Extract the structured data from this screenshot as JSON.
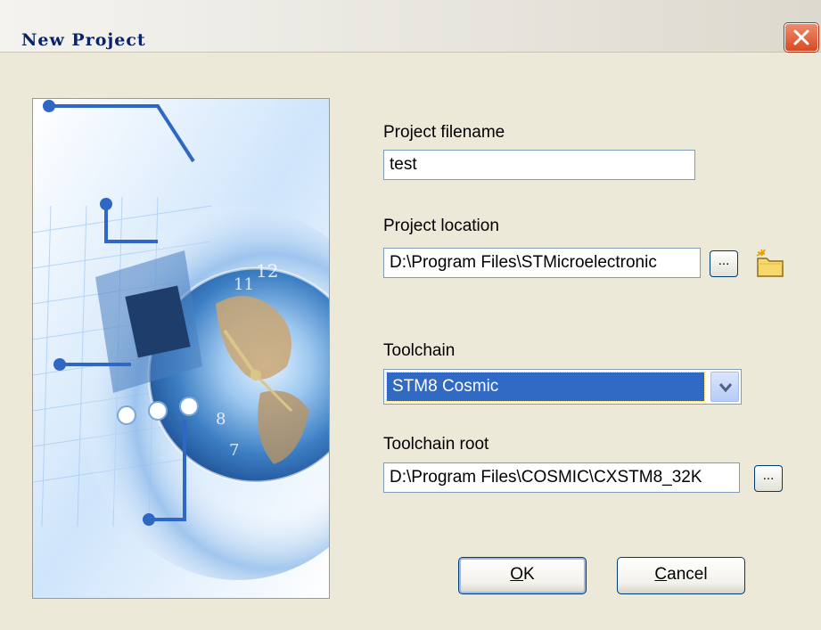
{
  "window": {
    "title": "New Project"
  },
  "fields": {
    "project_filename": {
      "label": "Project filename",
      "value": "test"
    },
    "project_location": {
      "label": "Project location",
      "value": "D:\\Program Files\\STMicroelectronic",
      "browse_label": "..."
    },
    "toolchain": {
      "label": "Toolchain",
      "selected": "STM8 Cosmic"
    },
    "toolchain_root": {
      "label": "Toolchain root",
      "value": "D:\\Program Files\\COSMIC\\CXSTM8_32K",
      "browse_label": "..."
    }
  },
  "buttons": {
    "ok": {
      "mnemonic": "O",
      "rest": "K"
    },
    "cancel": {
      "mnemonic": "C",
      "rest": "ancel"
    }
  },
  "icons": {
    "close": "close-icon",
    "new_folder": "new-folder-icon",
    "dropdown": "chevron-down-icon"
  },
  "colors": {
    "title_text": "#0a246a",
    "selection": "#316ac5",
    "dialog_bg": "#ECE9D8"
  }
}
